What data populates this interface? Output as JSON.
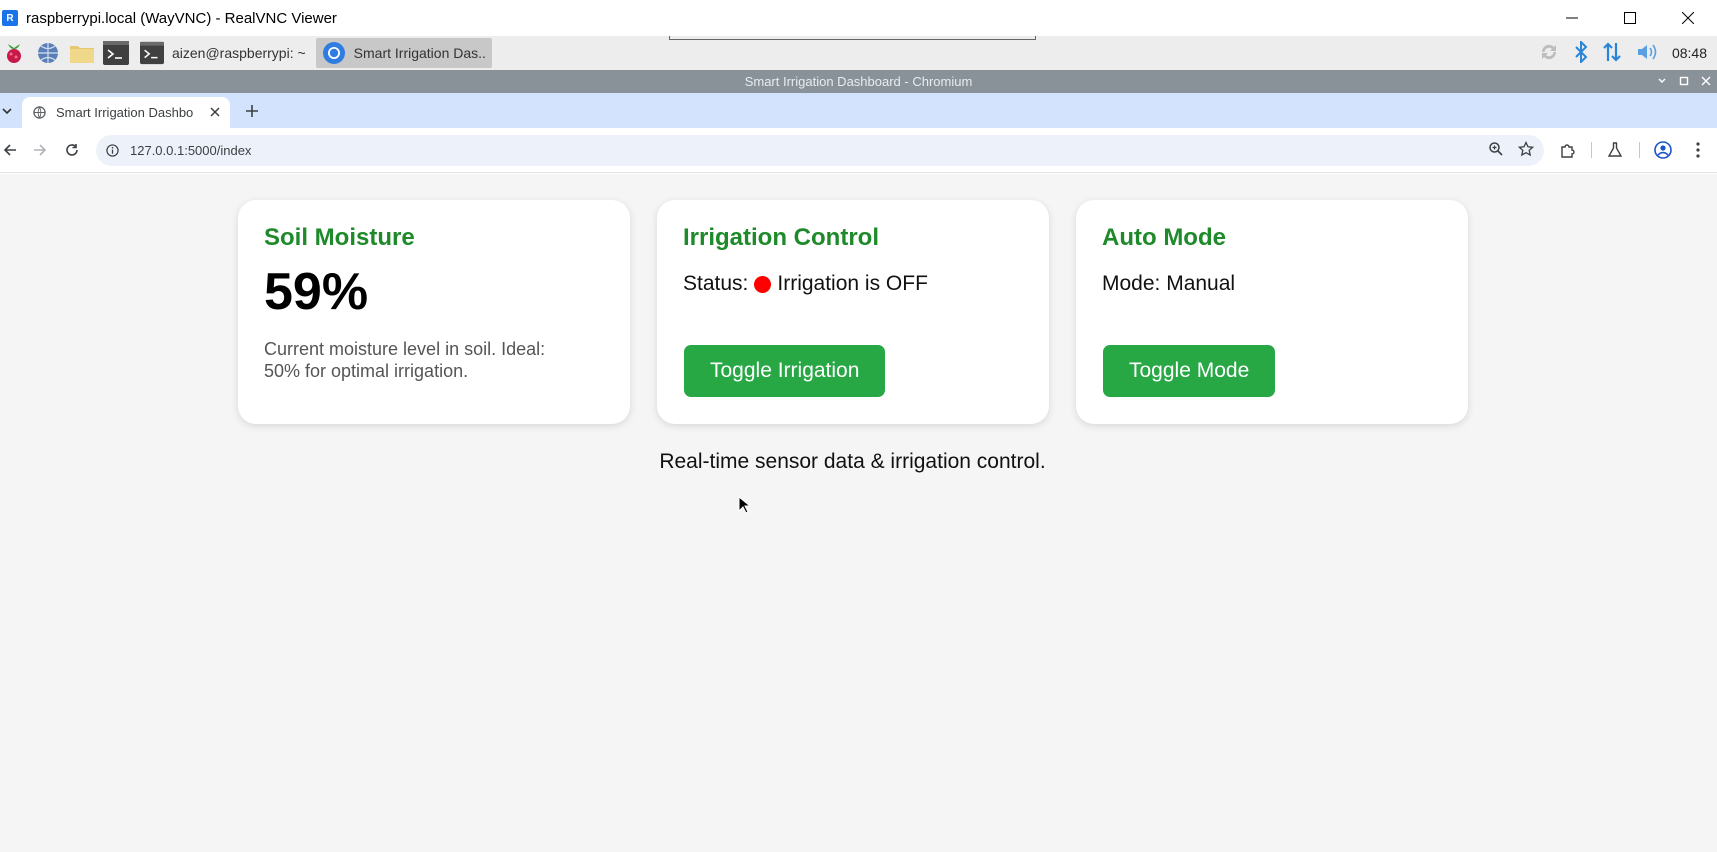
{
  "vnc": {
    "title": "raspberrypi.local (WayVNC) - RealVNC Viewer",
    "logo_text": "R"
  },
  "taskbar": {
    "tasks": [
      {
        "label": "aizen@raspberrypi: ~",
        "icon": "terminal-icon"
      },
      {
        "label": "Smart Irrigation Das..",
        "icon": "chromium-icon"
      }
    ],
    "clock": "08:48"
  },
  "chromium": {
    "window_title": "Smart Irrigation Dashboard - Chromium"
  },
  "tab": {
    "title": "Smart Irrigation Dashbo"
  },
  "omnibox": {
    "url": "127.0.0.1:5000/index"
  },
  "dashboard": {
    "soil": {
      "title": "Soil Moisture",
      "value": "59%",
      "description": "Current moisture level in soil. Ideal: 50% for optimal irrigation."
    },
    "irrigation": {
      "title": "Irrigation Control",
      "status_label": "Status:",
      "status_text": "Irrigation is OFF",
      "status_color": "#ff0000",
      "button_label": "Toggle Irrigation"
    },
    "auto": {
      "title": "Auto Mode",
      "mode_text": "Mode: Manual",
      "button_label": "Toggle Mode"
    },
    "footer": "Real-time sensor data & irrigation control."
  },
  "colors": {
    "accent_green": "#1e8a2a",
    "button_green": "#28a745",
    "tab_strip": "#d3e3fd"
  }
}
